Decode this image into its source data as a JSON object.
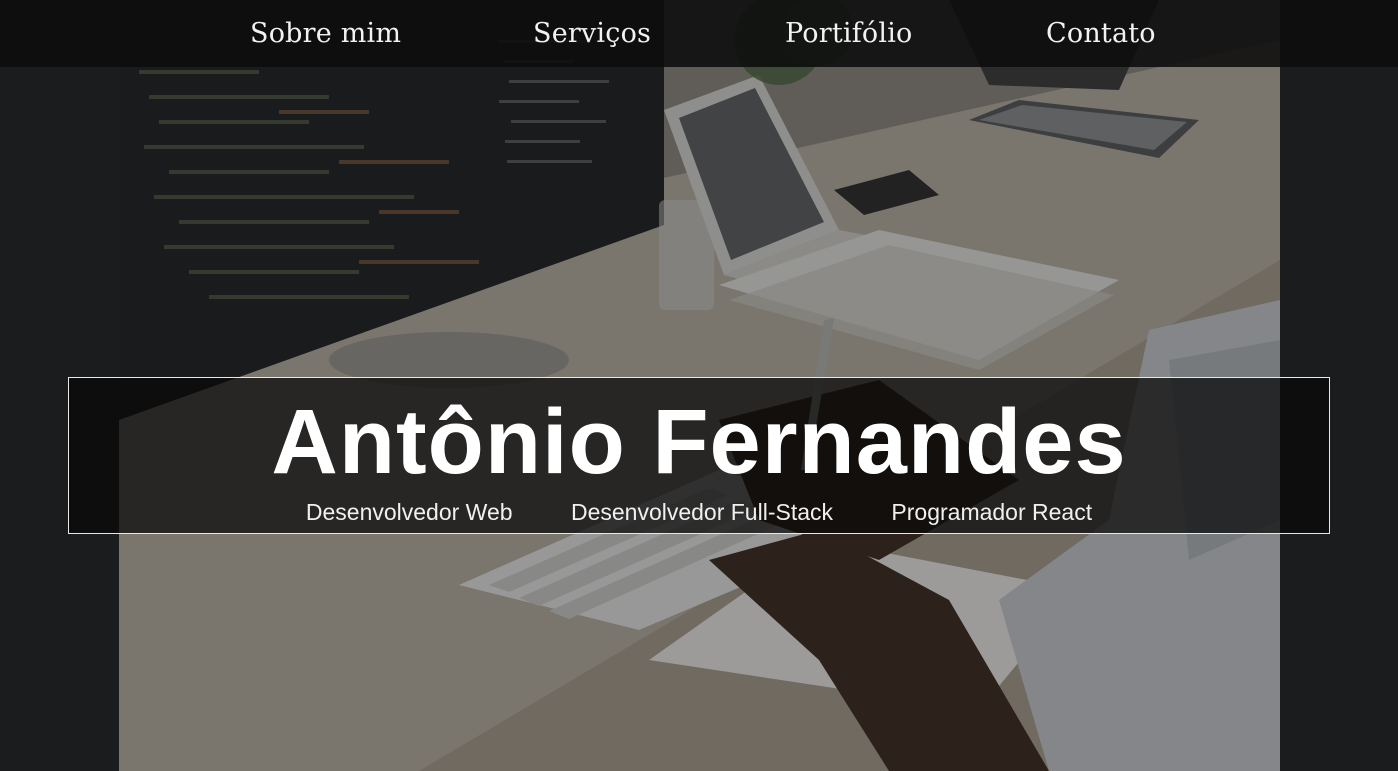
{
  "nav": {
    "items": [
      {
        "label": "Sobre mim"
      },
      {
        "label": "Serviços"
      },
      {
        "label": "Portifólio"
      },
      {
        "label": "Contato"
      }
    ]
  },
  "hero": {
    "name": "Antônio Fernandes",
    "roles": [
      "Desenvolvedor Web",
      "Desenvolvedor Full-Stack",
      "Programador React"
    ]
  },
  "colors": {
    "background": "#1b1c1e",
    "navbar": "#0c0c0c",
    "text": "#ffffff",
    "title_border": "#e8e8e8"
  }
}
